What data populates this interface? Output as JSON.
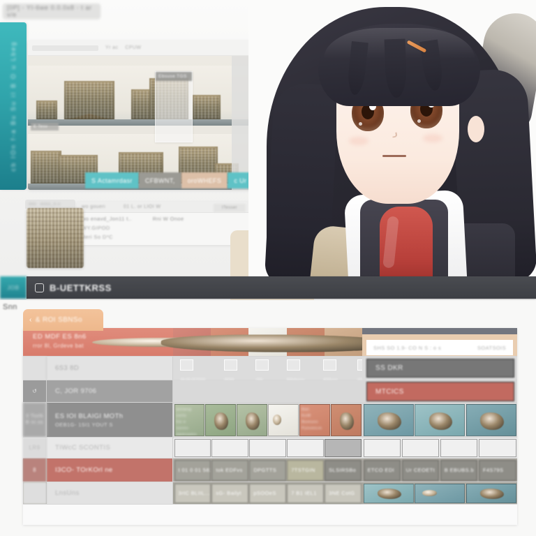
{
  "window": {
    "title_chip": "[0P] - YI-6we 0.0.0x8 - t ar v/e"
  },
  "rail": {
    "label": "cb IOn  f-a Bu Su il B O u  Lbeg"
  },
  "browser_card": {
    "address_placeholder": "",
    "head_text_1": "Yr ac",
    "head_text_2": "CPUW",
    "overlay_panel_title": "Ebsuse  TGS",
    "overlay_strip_text": "E Tesv"
  },
  "tabs": [
    {
      "label": "S Actamrdasr",
      "color": "#5fc2c6",
      "name": "tab-primary"
    },
    {
      "label": "CFBWNT,",
      "color": "#9b9a94",
      "name": "tab-secondary"
    },
    {
      "label": "oroWHEFS",
      "color": "#ddc0a8",
      "name": "tab-tertiary"
    },
    {
      "label": "c Ur",
      "color": "#5fc2c6",
      "name": "tab-quaternary"
    }
  ],
  "mini_tab": {
    "left": "sns",
    "right": "esss_n.s"
  },
  "detail_card": {
    "head_col_1": "wo goueri",
    "head_col_2": "01 L. or LIOI W",
    "button_label": "ITesser",
    "row_1_a": "wo enavd_Jon11 t..",
    "row_1_b": "Rni W Onoe",
    "line_2": "WY.GIPOD",
    "line_3": "Beri So D*C"
  },
  "status_bar": {
    "rail_text": "JOB",
    "icon": "grid-icon",
    "text": "B-UETTKRSS"
  },
  "bottom": {
    "section_label": "Snn",
    "orange_tab": {
      "icon": "chevron-left-icon",
      "label": "& ROI SBNSo"
    }
  },
  "table": {
    "header_row": {
      "title": "ED MDF ES 8n6",
      "subtitle": "rror 8I, Grdeve bat",
      "field_text_left": "SHS SO 1.9- CO  N S : o s",
      "field_text_right": "SOATSOIS",
      "thumbs": [
        "doll-thumb",
        "figure-thumb",
        "sketch-thumb",
        "bust-thumb",
        "flower-thumb"
      ]
    },
    "rows": [
      {
        "name": "row-icons",
        "num": "",
        "label": "6S3 8D",
        "sublabel": "",
        "mid_type": "icons",
        "icons": [
          {
            "name": "photo-icon",
            "caption": "3E3E3FDSR"
          },
          {
            "name": "list-icon",
            "caption": "I8I9E 8Et"
          },
          {
            "name": "table-icon",
            "caption": "JSE"
          },
          {
            "name": "image-icon",
            "caption": "BRHteou /H"
          },
          {
            "name": "grid-icon",
            "caption": "BSEeV,"
          },
          {
            "name": "mosaic-icon",
            "caption": "SELIMOjr"
          }
        ],
        "right_type": "button-gray",
        "right_label": "SS DKR"
      },
      {
        "name": "row-restore",
        "num": "↺",
        "label": "C, JOR 9706",
        "sublabel": "",
        "mid_type": "empty",
        "right_type": "button-red",
        "right_label": "MTCICS"
      },
      {
        "name": "row-gallery",
        "num": "3\nTsoN B\nnr.ss",
        "label": "ES IOI BLAIGI MOTh",
        "sublabel": "OEB1G- 1SI1 YOUT S",
        "mid_type": "thumbs",
        "right_type": "thumbs",
        "mid_thumbs": [
          "text-thumb",
          "creature-thumb",
          "creature2-thumb",
          "snow-thumb",
          "text2-thumb",
          "dark-thumb"
        ],
        "right_thumbs": [
          "sea-thumb",
          "sea2-thumb",
          "sea3-thumb"
        ]
      },
      {
        "name": "row-contents",
        "num": "LR9",
        "label": "TIWcC SCONTIS",
        "sublabel": "",
        "mid_type": "cells-blank",
        "right_type": "cells-blank"
      },
      {
        "name": "row-tomorrow",
        "num": "8",
        "label": "I3CO- TOrKOrl ne",
        "sublabel": "",
        "mid_type": "cells-text",
        "mid_cells": [
          "t 01 0 01 582",
          "tok EDFvs",
          "DPGTTS",
          "7TSTGIN",
          "SLSIRSBo"
        ],
        "right_type": "cells-text",
        "right_cells": [
          "ETCO EDI",
          "Ur CEOETt",
          "B EBUBS.b",
          "F4S79S"
        ]
      },
      {
        "name": "row-history",
        "num": "",
        "label": "LnsUns",
        "sublabel": "",
        "mid_type": "cells-text",
        "mid_cells": [
          "3rtC BLIIL...",
          "sG- Bailyt",
          "pSOOeS",
          "7 B1 IEL1",
          "3NE CotG"
        ],
        "right_type": "cells-images",
        "right_thumbs": [
          "sea4-thumb",
          "sea5-thumb",
          "sea6-thumb"
        ]
      }
    ]
  },
  "colors": {
    "teal": "#3fb9bd",
    "salmon": "#dd8274",
    "tan": "#ddc0a8",
    "dark_bar": "#4a4c51",
    "red_button": "#c26a60"
  }
}
